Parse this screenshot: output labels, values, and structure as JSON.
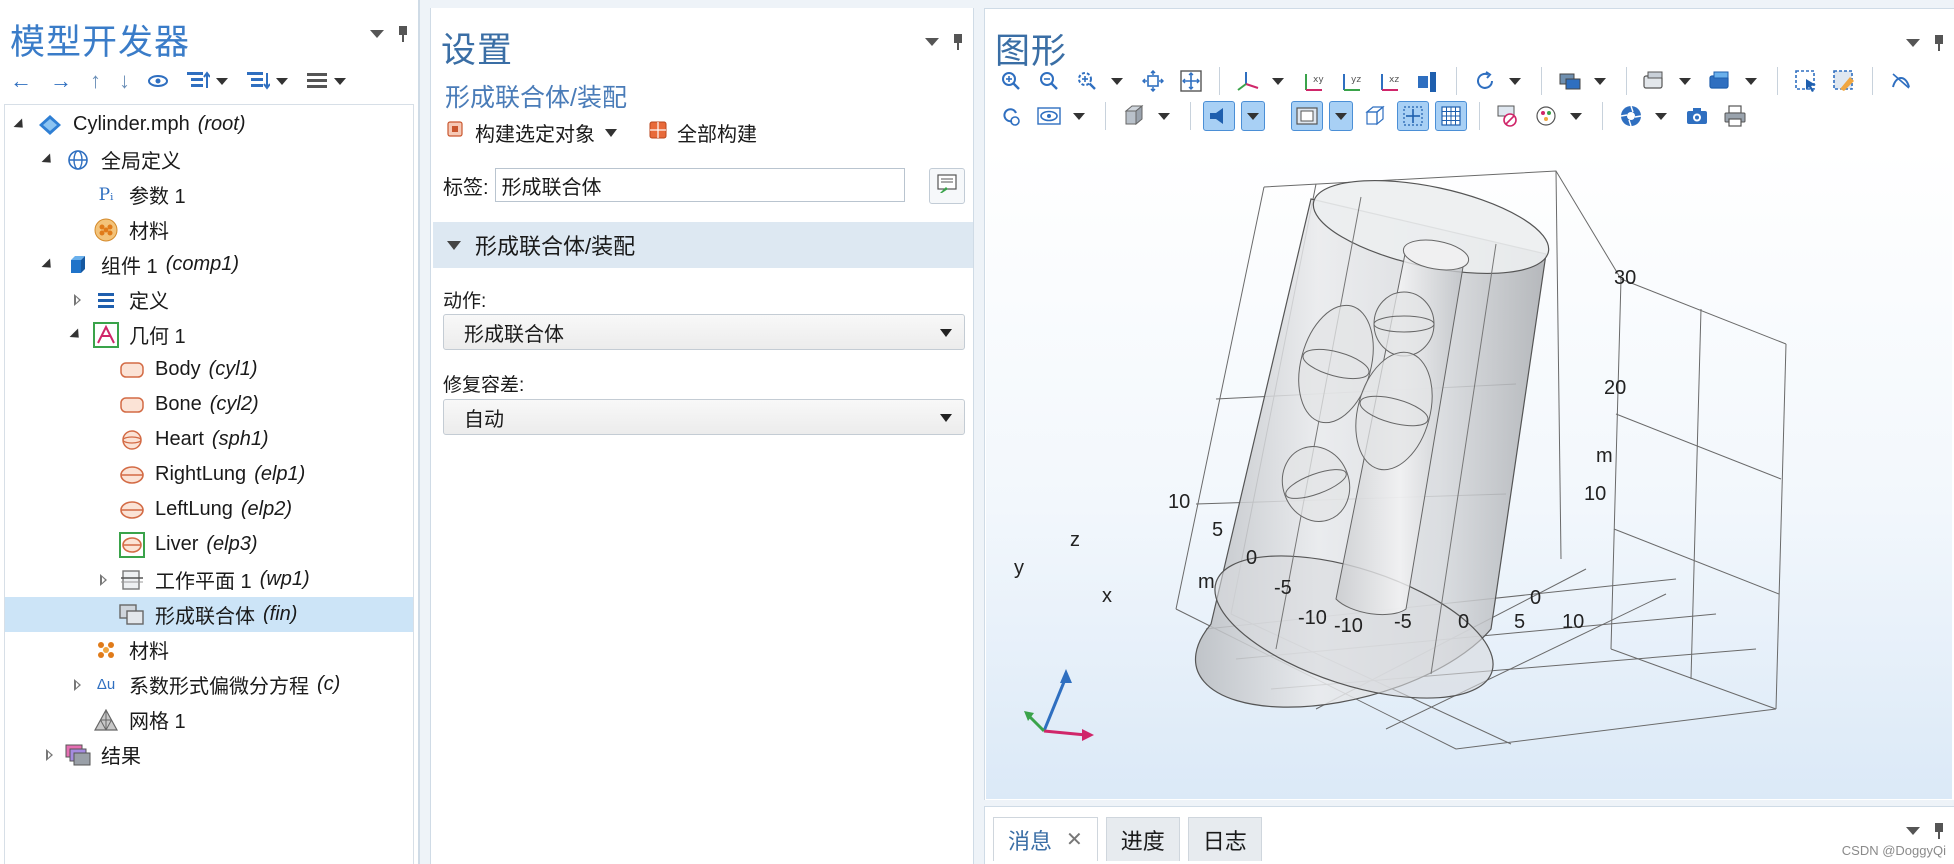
{
  "left_panel": {
    "title": "模型开发器",
    "tree": [
      {
        "label": "Cylinder.mph",
        "tag": "(root)",
        "icon": "mph-file-icon"
      },
      {
        "label": "全局定义",
        "tag": "",
        "icon": "globe-icon"
      },
      {
        "label": "参数 1",
        "tag": "",
        "icon": "parameters-icon"
      },
      {
        "label": "材料",
        "tag": "",
        "icon": "materials-icon"
      },
      {
        "label": "组件 1",
        "tag": "(comp1)",
        "icon": "component-cube-icon"
      },
      {
        "label": "定义",
        "tag": "",
        "icon": "definitions-icon"
      },
      {
        "label": "几何 1",
        "tag": "",
        "icon": "geometry-icon"
      },
      {
        "label": "Body",
        "tag": "(cyl1)",
        "icon": "cylinder-icon"
      },
      {
        "label": "Bone",
        "tag": "(cyl2)",
        "icon": "cylinder-icon"
      },
      {
        "label": "Heart",
        "tag": "(sph1)",
        "icon": "sphere-icon"
      },
      {
        "label": "RightLung",
        "tag": "(elp1)",
        "icon": "ellipsoid-icon"
      },
      {
        "label": "LeftLung",
        "tag": "(elp2)",
        "icon": "ellipsoid-icon"
      },
      {
        "label": "Liver",
        "tag": "(elp3)",
        "icon": "ellipsoid-selected-icon"
      },
      {
        "label": "工作平面 1",
        "tag": "(wp1)",
        "icon": "work-plane-icon"
      },
      {
        "label": "形成联合体",
        "tag": "(fin)",
        "icon": "form-union-icon"
      },
      {
        "label": "材料",
        "tag": "",
        "icon": "materials-icon"
      },
      {
        "label": "系数形式偏微分方程",
        "tag": "(c)",
        "icon": "pde-icon"
      },
      {
        "label": "网格 1",
        "tag": "",
        "icon": "mesh-icon"
      },
      {
        "label": "结果",
        "tag": "",
        "icon": "results-icon"
      }
    ],
    "toolbar_icons": [
      "back-arrow-icon",
      "forward-arrow-icon",
      "move-up-icon",
      "move-down-icon",
      "show-icon",
      "expand-sections-icon",
      "collapse-sections-icon",
      "more-icon"
    ]
  },
  "settings_panel": {
    "title": "设置",
    "subtitle": "形成联合体/装配",
    "build_selected": "构建选定对象",
    "build_all": "全部构建",
    "label_caption": "标签:",
    "label_value": "形成联合体",
    "section_title": "形成联合体/装配",
    "action_label": "动作:",
    "action_value": "形成联合体",
    "repair_label": "修复容差:",
    "repair_value": "自动"
  },
  "graphics_panel": {
    "title": "图形",
    "x_ticks": [
      "-10",
      "-5",
      "0",
      "5",
      "10"
    ],
    "y_ticks": [
      "10",
      "5",
      "0",
      "-5",
      "-10"
    ],
    "z_ticks": [
      "0",
      "10",
      "20",
      "30"
    ],
    "x_unit": "m",
    "y_unit": "m",
    "z_unit": "m",
    "triad": {
      "x": "x",
      "y": "y",
      "z": "z"
    },
    "colors": {
      "triad_x": "#d0266a",
      "triad_y": "#3aa34a",
      "triad_z": "#2f6fc0",
      "selected_button": "#a8d0f5"
    }
  },
  "bottom_panel": {
    "tabs": [
      "消息",
      "进度",
      "日志"
    ],
    "close_glyph": "✕",
    "watermark": "CSDN @DoggyQi"
  }
}
